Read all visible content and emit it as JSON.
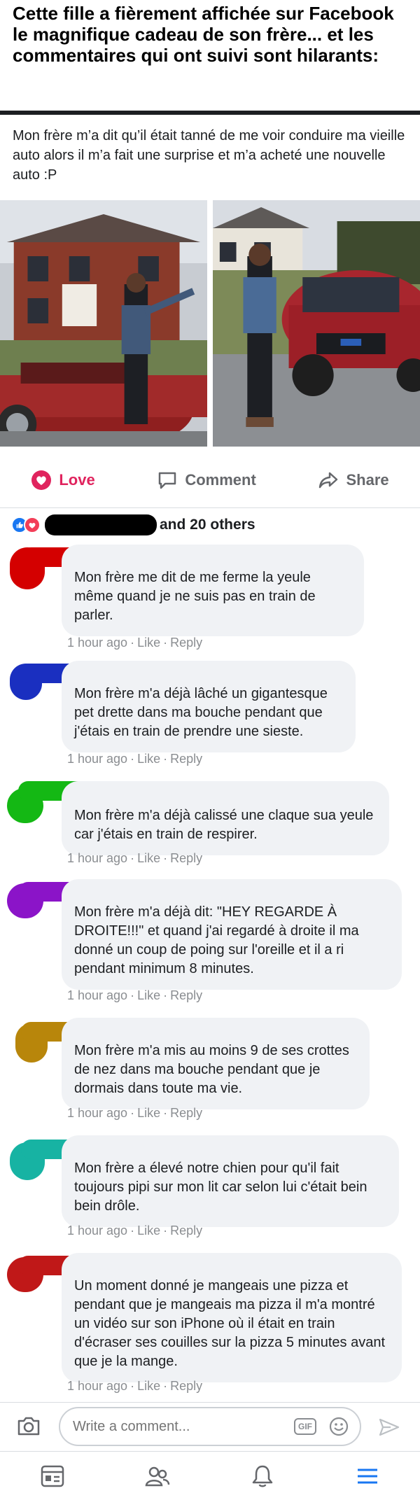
{
  "headline": "Cette fille a fièrement affichée sur Facebook le magnifique cadeau de son frère... et les commentaires qui ont suivi sont hilarants:",
  "post": {
    "text": "Mon frère m’a dit qu’il était tanné de me voir conduire ma vieille auto alors il m’a fait une surprise et m’a acheté une nouvelle auto :P"
  },
  "actions": {
    "love_label": "Love",
    "comment_label": "Comment",
    "share_label": "Share"
  },
  "reactions": {
    "others_text": "and 20 others"
  },
  "comments": [
    {
      "text": "Mon frère me dit de me ferme la yeule même quand je ne suis pas en train de parler.",
      "time": "1 hour ago",
      "like": "Like",
      "reply": "Reply",
      "redaction_color": "#d40000"
    },
    {
      "text": "Mon frère m'a déjà lâché un gigantesque pet drette dans ma bouche pendant que j'étais en train de prendre une sieste.",
      "time": "1 hour ago",
      "like": "Like",
      "reply": "Reply",
      "redaction_color": "#1a2fc0"
    },
    {
      "text": "Mon frère m'a déjà calissé une claque sua yeule car j'étais en train de respirer.",
      "time": "1 hour ago",
      "like": "Like",
      "reply": "Reply",
      "redaction_color": "#14b814"
    },
    {
      "text": "Mon frère m'a déjà dit: \"HEY REGARDE À DROITE!!!\" et quand j'ai regardé à droite il ma donné un coup de poing sur l'oreille et il a ri pendant minimum 8 minutes.",
      "time": "1 hour ago",
      "like": "Like",
      "reply": "Reply",
      "redaction_color": "#8b14c8"
    },
    {
      "text": "Mon frère m'a mis au moins 9 de ses crottes de nez dans ma bouche pendant que je dormais dans toute ma vie.",
      "time": "1 hour ago",
      "like": "Like",
      "reply": "Reply",
      "redaction_color": "#b8860b"
    },
    {
      "text": "Mon frère a élevé notre chien pour qu'il fait toujours pipi sur mon lit car selon lui c'était bein bein drôle.",
      "time": "1 hour ago",
      "like": "Like",
      "reply": "Reply",
      "redaction_color": "#17b3a3"
    },
    {
      "text": "Un moment donné je mangeais une pizza et pendant que je mangeais ma pizza il m'a montré un vidéo sur son iPhone où il était en train d'écraser ses couilles sur la pizza 5 minutes avant que je la mange.",
      "time": "1 hour ago",
      "like": "Like",
      "reply": "Reply",
      "redaction_color": "#c01818"
    }
  ],
  "composer": {
    "placeholder": "Write a comment...",
    "gif_label": "GIF"
  },
  "icons": {
    "love": "heart-icon",
    "comment": "speech-bubble-icon",
    "share": "share-arrow-icon",
    "camera": "camera-icon",
    "emoji": "emoji-icon",
    "send": "send-icon",
    "tabs": [
      "news-feed-icon",
      "friends-icon",
      "notifications-icon",
      "menu-icon"
    ]
  },
  "colors": {
    "accent": "#1877f2",
    "love": "#e0245e",
    "bubble": "#f0f2f5",
    "meta": "#8a8d91"
  }
}
